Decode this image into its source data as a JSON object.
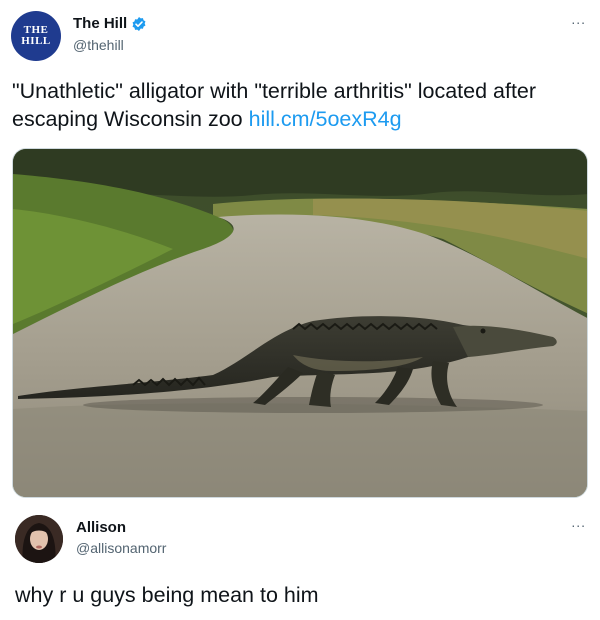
{
  "tweet": {
    "avatar_text": [
      "THE",
      "HILL"
    ],
    "display_name": "The Hill",
    "handle": "@thehill",
    "more_label": "...",
    "text": "\"Unathletic\" alligator with \"terrible arthritis\" located after escaping Wisconsin zoo ",
    "link": "hill.cm/5oexR4g",
    "image_subject": "alligator crossing a sandy dirt road",
    "colors": {
      "brand": "#1f3b8f",
      "link": "#1d9bf0",
      "verified": "#1d9bf0"
    },
    "icons": [
      "verified-badge-icon",
      "more-options-icon"
    ]
  },
  "reply": {
    "display_name": "Allison",
    "handle": "@allisonamorr",
    "more_label": "...",
    "text": "why r u guys being mean to him"
  }
}
